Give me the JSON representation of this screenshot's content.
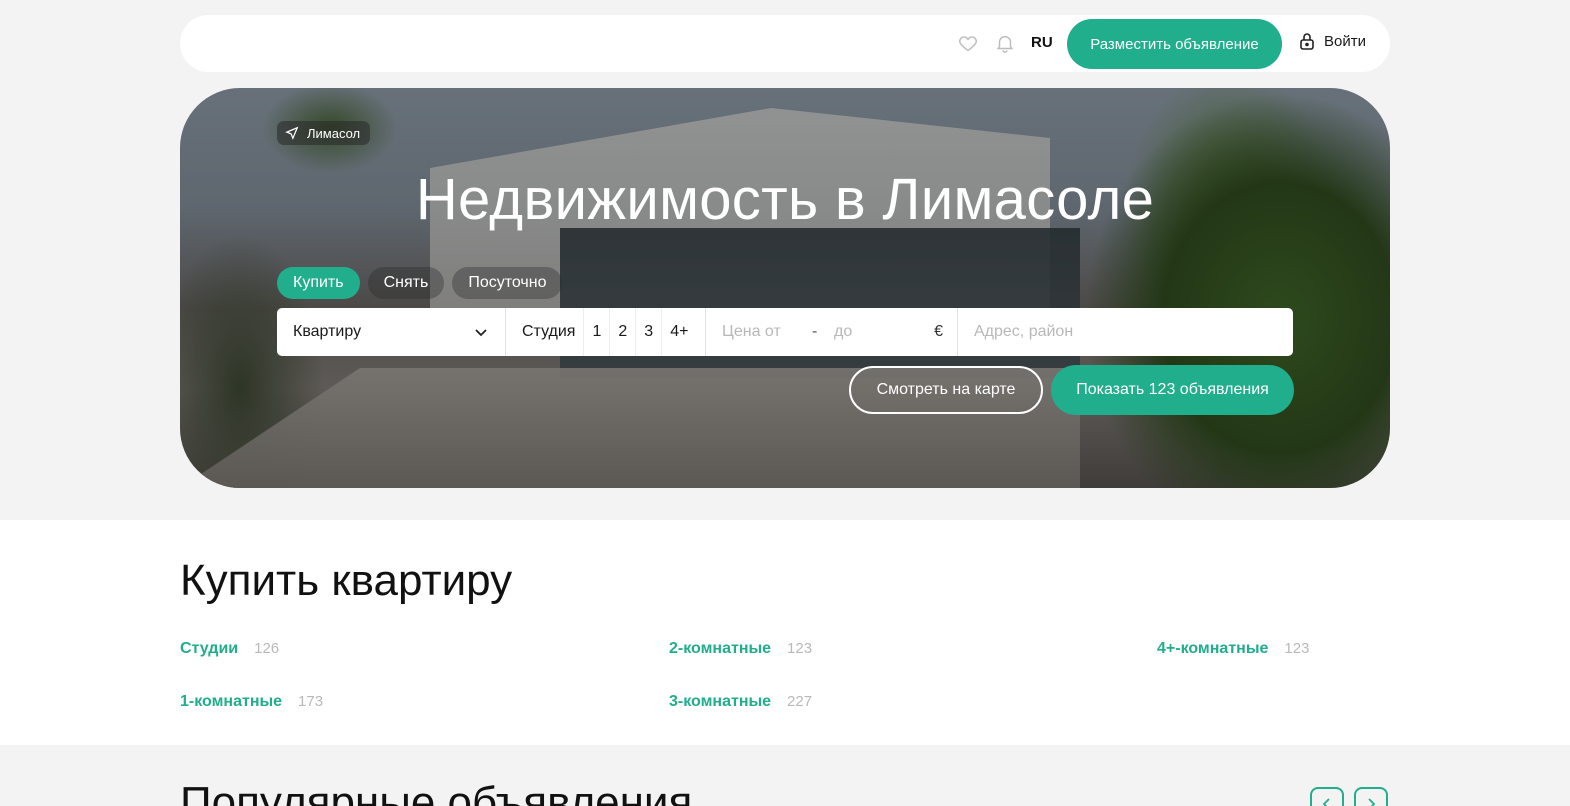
{
  "header": {
    "language": "RU",
    "post_ad_label": "Разместить объявление",
    "login_label": "Войти",
    "icons": [
      "heart-icon",
      "bell-icon",
      "lock-icon"
    ]
  },
  "hero": {
    "location_chip": "Лимасол",
    "title": "Недвижимость в Лимасоле",
    "tabs": [
      {
        "label": "Купить",
        "active": true
      },
      {
        "label": "Снять",
        "active": false
      },
      {
        "label": "Посуточно",
        "active": false
      }
    ],
    "search": {
      "property_type": "Квартиру",
      "rooms": [
        "Студия",
        "1",
        "2",
        "3",
        "4+"
      ],
      "price_from_placeholder": "Цена от",
      "price_separator": "-",
      "price_to_placeholder": "до",
      "currency": "€",
      "address_placeholder": "Адрес, район"
    },
    "map_button": "Смотреть на карте",
    "show_button": "Показать 123 объявления"
  },
  "buy_section": {
    "title": "Купить квартиру",
    "categories": [
      {
        "label": "Студии",
        "count": "126"
      },
      {
        "label": "1-комнатные",
        "count": "173"
      },
      {
        "label": "2-комнатные",
        "count": "123"
      },
      {
        "label": "3-комнатные",
        "count": "227"
      },
      {
        "label": "4+-комнатные",
        "count": "123"
      }
    ]
  },
  "popular_section": {
    "title": "Популярные объявления"
  },
  "colors": {
    "accent": "#20ae8c",
    "page_bg": "#f3f3f3",
    "muted": "#b9b9b9"
  }
}
